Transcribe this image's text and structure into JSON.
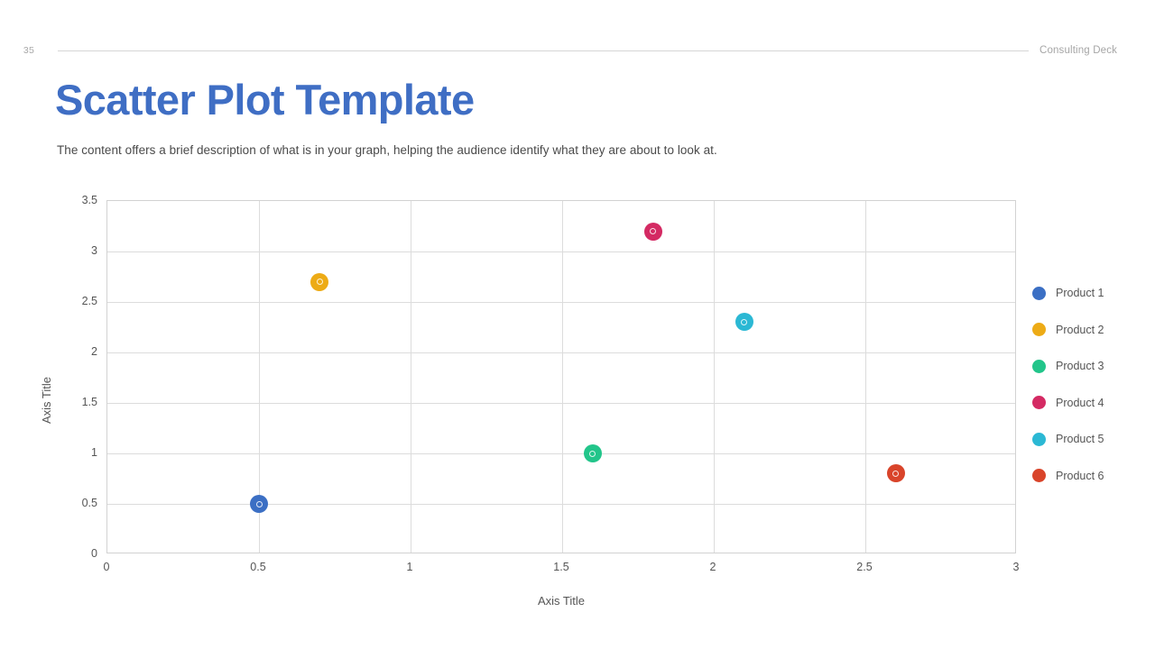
{
  "header": {
    "page_number": "35",
    "deck_name": "Consulting Deck"
  },
  "title": "Scatter Plot Template",
  "subtitle": "The content offers a brief description of what is in your graph, helping the audience identify what they are about to look at.",
  "colors": {
    "title_blue": "#3f6ec4",
    "grid": "#dcdcdc",
    "axis_text": "#555555",
    "header_text": "#a6a6a6"
  },
  "chart_data": {
    "type": "scatter",
    "title": "",
    "xlabel": "Axis Title",
    "ylabel": "Axis Title",
    "xlim": [
      0,
      3
    ],
    "ylim": [
      0,
      3.5
    ],
    "xticks": [
      "0",
      "0.5",
      "1",
      "1.5",
      "2",
      "2.5",
      "3"
    ],
    "xtick_values": [
      0,
      0.5,
      1,
      1.5,
      2,
      2.5,
      3
    ],
    "yticks": [
      "0",
      "0.5",
      "1",
      "1.5",
      "2",
      "2.5",
      "3",
      "3.5"
    ],
    "ytick_values": [
      0,
      0.5,
      1,
      1.5,
      2,
      2.5,
      3,
      3.5
    ],
    "grid": true,
    "grid_x_values": [
      0.5,
      1,
      1.5,
      2,
      2.5
    ],
    "grid_y_values": [
      0.5,
      1,
      1.5,
      2,
      2.5,
      3
    ],
    "legend_position": "right",
    "series": [
      {
        "name": "Product 1",
        "color": "#3b6fc4",
        "x": 0.5,
        "y": 0.5
      },
      {
        "name": "Product 2",
        "color": "#edab16",
        "x": 0.7,
        "y": 2.7
      },
      {
        "name": "Product 3",
        "color": "#22c58a",
        "x": 1.6,
        "y": 1.0
      },
      {
        "name": "Product 4",
        "color": "#d42a63",
        "x": 1.8,
        "y": 3.2
      },
      {
        "name": "Product 5",
        "color": "#2bb8d4",
        "x": 2.1,
        "y": 2.3
      },
      {
        "name": "Product 6",
        "color": "#d9442a",
        "x": 2.6,
        "y": 0.8
      }
    ]
  }
}
